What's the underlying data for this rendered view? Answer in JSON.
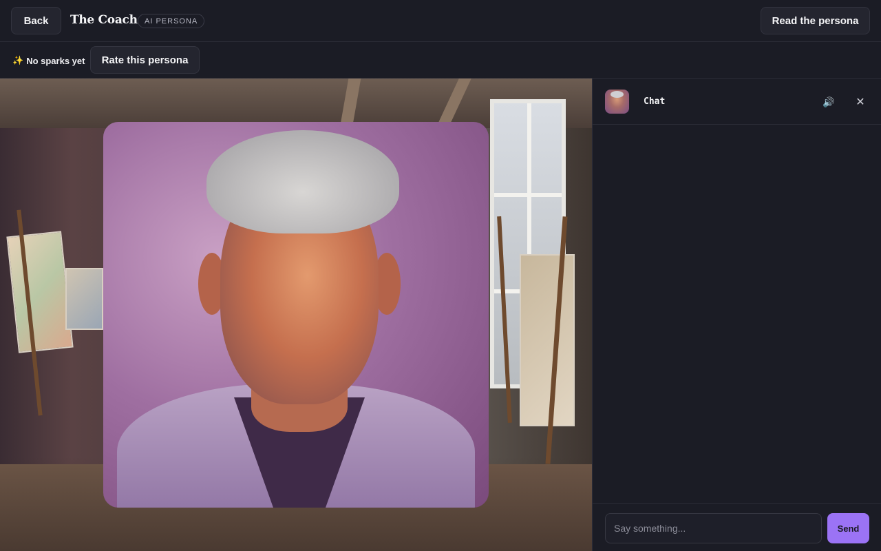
{
  "header": {
    "back_label": "Back",
    "title": "The Coach",
    "badge": "AI PERSONA",
    "read_label": "Read the persona"
  },
  "subbar": {
    "sparkle_icon": "sparkles-icon",
    "sparks_text": "No sparks yet",
    "rate_label": "Rate this persona"
  },
  "chat": {
    "title": "Chat",
    "speaker_icon": "speaker-icon",
    "close_icon": "close-icon",
    "input_placeholder": "Say something...",
    "input_value": "",
    "send_label": "Send",
    "messages": []
  },
  "colors": {
    "background": "#1b1c25",
    "surface": "#24252f",
    "border": "#2c2d38",
    "accent": "#9b73f5"
  }
}
